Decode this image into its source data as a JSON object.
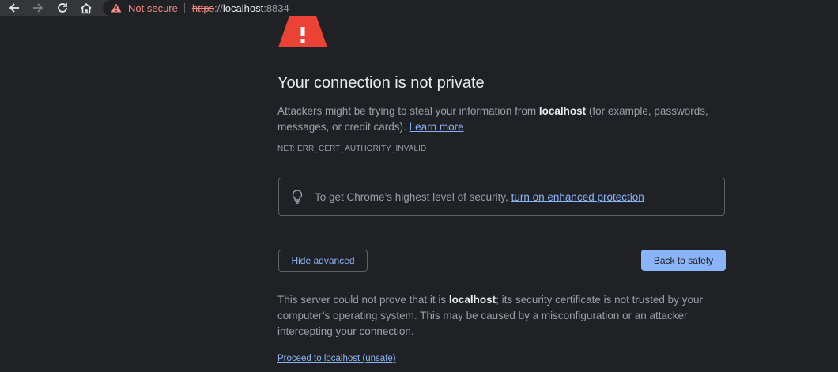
{
  "browser": {
    "back_icon": "arrow-left-icon",
    "forward_icon": "arrow-right-icon",
    "reload_icon": "reload-icon",
    "home_icon": "home-icon",
    "security_chip": {
      "icon": "warning-triangle-icon",
      "label": "Not secure",
      "color": "#f28b82"
    },
    "url": {
      "scheme": "https",
      "separator": "://",
      "host": "localhost",
      "port": ":8834"
    }
  },
  "interstitial": {
    "icon": "warning-triangle-icon",
    "icon_color": "#ea4335",
    "title": "Your connection is not private",
    "lead_before": "Attackers might be trying to steal your information from ",
    "lead_host": "localhost",
    "lead_after": " (for example, passwords, messages, or credit cards). ",
    "learn_more": "Learn more",
    "error_code": "NET::ERR_CERT_AUTHORITY_INVALID",
    "promo": {
      "icon": "lightbulb-icon",
      "text": "To get Chrome’s highest level of security, ",
      "link": "turn on enhanced protection"
    },
    "hide_advanced_label": "Hide advanced",
    "back_to_safety_label": "Back to safety",
    "details_before": "This server could not prove that it is ",
    "details_host": "localhost",
    "details_after": "; its security certificate is not trusted by your computer’s operating system. This may be caused by a misconfiguration or an attacker intercepting your connection.",
    "proceed_link": "Proceed to localhost (unsafe)",
    "accent_color": "#8ab4f8"
  }
}
